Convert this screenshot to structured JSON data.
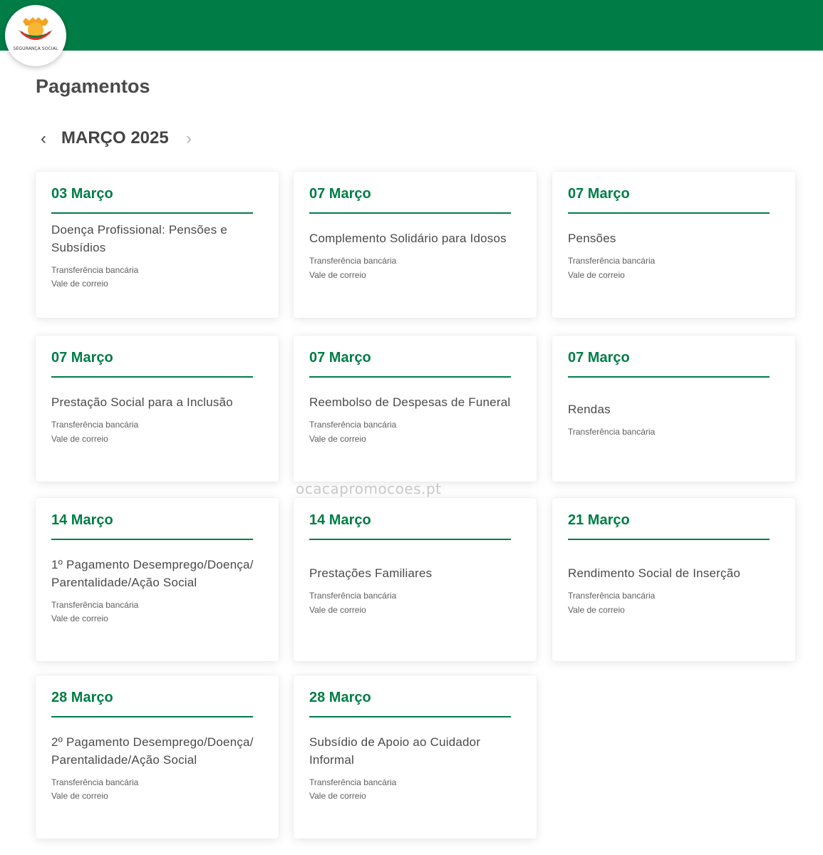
{
  "logo": {
    "text": "SEGURANÇA SOCIAL"
  },
  "page": {
    "title": "Pagamentos"
  },
  "nav": {
    "month": "MARÇO 2025",
    "prev_icon": "chevron-left-icon",
    "next_icon": "chevron-right-icon"
  },
  "watermark": "ocacapromocoes.pt",
  "colors": {
    "brand_green": "#007d46"
  },
  "cards": [
    {
      "date": "03 Março",
      "title": "Doença Profissional: Pensões e Subsídios",
      "methods": [
        "Transferência bancária",
        "Vale de correio"
      ]
    },
    {
      "date": "07 Março",
      "title": "Complemento Solidário para Idosos",
      "methods": [
        "Transferência bancária",
        "Vale de correio"
      ]
    },
    {
      "date": "07 Março",
      "title": "Pensões",
      "methods": [
        "Transferência bancária",
        "Vale de correio"
      ]
    },
    {
      "date": "07 Março",
      "title": "Prestação Social para a Inclusão",
      "methods": [
        "Transferência bancária",
        "Vale de correio"
      ]
    },
    {
      "date": "07 Março",
      "title": "Reembolso de Despesas de Funeral",
      "methods": [
        "Transferência bancária",
        "Vale de correio"
      ]
    },
    {
      "date": "07 Março",
      "title": "Rendas",
      "methods": [
        "Transferência bancária"
      ]
    },
    {
      "date": "14 Março",
      "title": "1º Pagamento Desemprego/Doença/ Parentalidade/Ação Social",
      "methods": [
        "Transferência bancária",
        "Vale de correio"
      ]
    },
    {
      "date": "14 Março",
      "title": "Prestações Familiares",
      "methods": [
        "Transferência bancária",
        "Vale de correio"
      ]
    },
    {
      "date": "21 Março",
      "title": "Rendimento Social de Inserção",
      "methods": [
        "Transferência bancária",
        "Vale de correio"
      ]
    },
    {
      "date": "28 Março",
      "title": "2º Pagamento Desemprego/Doença/ Parentalidade/Ação Social",
      "methods": [
        "Transferência bancária",
        "Vale de correio"
      ]
    },
    {
      "date": "28 Março",
      "title": "Subsídio de Apoio ao Cuidador Informal",
      "methods": [
        "Transferência bancária",
        "Vale de correio"
      ]
    }
  ]
}
